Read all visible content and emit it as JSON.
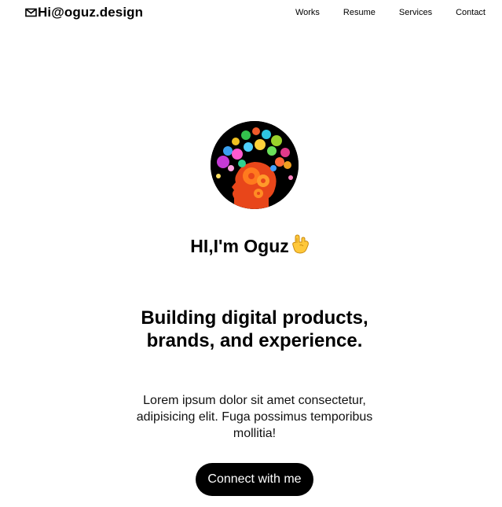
{
  "header": {
    "brand_text": "Hi@oguz.design",
    "brand_icon": "mail-icon",
    "nav": [
      {
        "label": "Works"
      },
      {
        "label": "Resume"
      },
      {
        "label": "Services"
      },
      {
        "label": "Contact"
      }
    ]
  },
  "hero": {
    "avatar_alt": "head-with-colorful-icons",
    "greeting": "HI,I'm Oguz",
    "greeting_icon": "rock-hand-emoji-icon",
    "headline": "Building digital products, brands, and experience.",
    "lede": "Lorem ipsum dolor sit amet consectetur, adipisicing elit. Fuga possimus temporibus mollitia!",
    "cta_label": "Connect with me"
  },
  "colors": {
    "background": "#ffffff",
    "text": "#000000",
    "cta_bg": "#000000",
    "cta_text": "#ffffff"
  }
}
